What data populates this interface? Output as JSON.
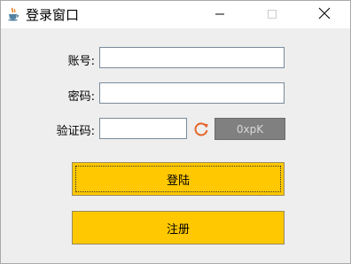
{
  "window": {
    "title": "登录窗口",
    "icons": {
      "app": "java-coffee-cup-icon",
      "minimize": "minimize-icon",
      "maximize": "maximize-icon",
      "close": "close-icon"
    }
  },
  "form": {
    "account_label": "账号:",
    "account_value": "",
    "password_label": "密码:",
    "password_value": "",
    "captcha_label": "验证码:",
    "captcha_value": "",
    "captcha_image_text": "0xpK",
    "refresh_icon": "refresh-icon"
  },
  "buttons": {
    "login_label": "登陆",
    "register_label": "注册"
  },
  "colors": {
    "button_yellow": "#ffc800",
    "content_background": "#eeeeee",
    "captcha_background": "#808080",
    "refresh_orange": "#e8642a"
  }
}
